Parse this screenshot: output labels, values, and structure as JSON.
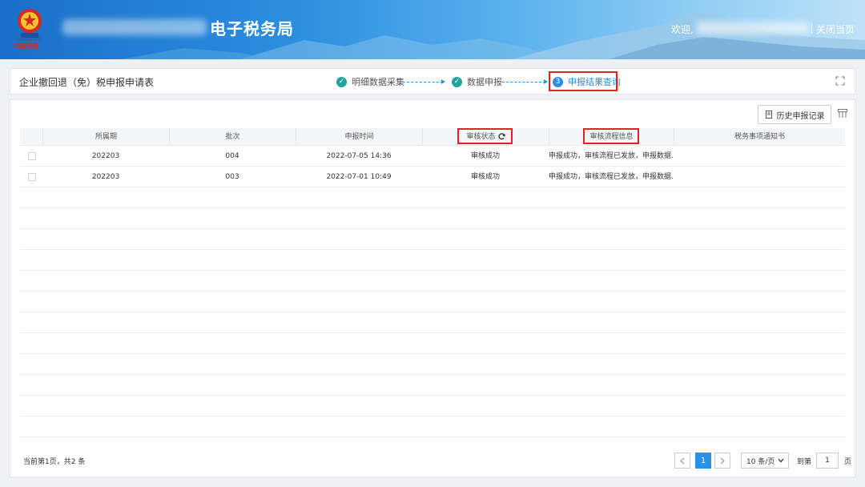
{
  "header": {
    "app_title": "电子税务局",
    "emblem_text": "中国税务",
    "welcome": "欢迎,",
    "close_page": "关闭当页"
  },
  "stepbar": {
    "form_title": "企业撤回退（免）税申报申请表",
    "steps": [
      {
        "label": "明细数据采集",
        "state": "done"
      },
      {
        "label": "数据申报",
        "state": "done"
      },
      {
        "number": "3",
        "label": "申报结果查询",
        "state": "current"
      }
    ]
  },
  "toolbar": {
    "history_label": "历史申报记录"
  },
  "table": {
    "headers": [
      "所属期",
      "批次",
      "申报时间",
      "审核状态",
      "审核流程信息",
      "税务事项通知书"
    ],
    "rows": [
      {
        "period": "202203",
        "batch": "004",
        "time": "2022-07-05 14:36",
        "status": "审核成功",
        "flow": "申报成功，审核流程已发放，申报数据...",
        "notice": ""
      },
      {
        "period": "202203",
        "batch": "003",
        "time": "2022-07-01 10:49",
        "status": "审核成功",
        "flow": "申报成功，审核流程已发放，申报数据...",
        "notice": ""
      }
    ]
  },
  "pagination": {
    "info": "当前第1页，共2 条",
    "current_page": "1",
    "page_size": "10 条/页",
    "goto_label": "到第",
    "goto_value": "1",
    "page_unit": "页"
  },
  "colors": {
    "accent": "#2b8fe3",
    "done_step": "#1fa5a0",
    "highlight": "#e02424"
  }
}
